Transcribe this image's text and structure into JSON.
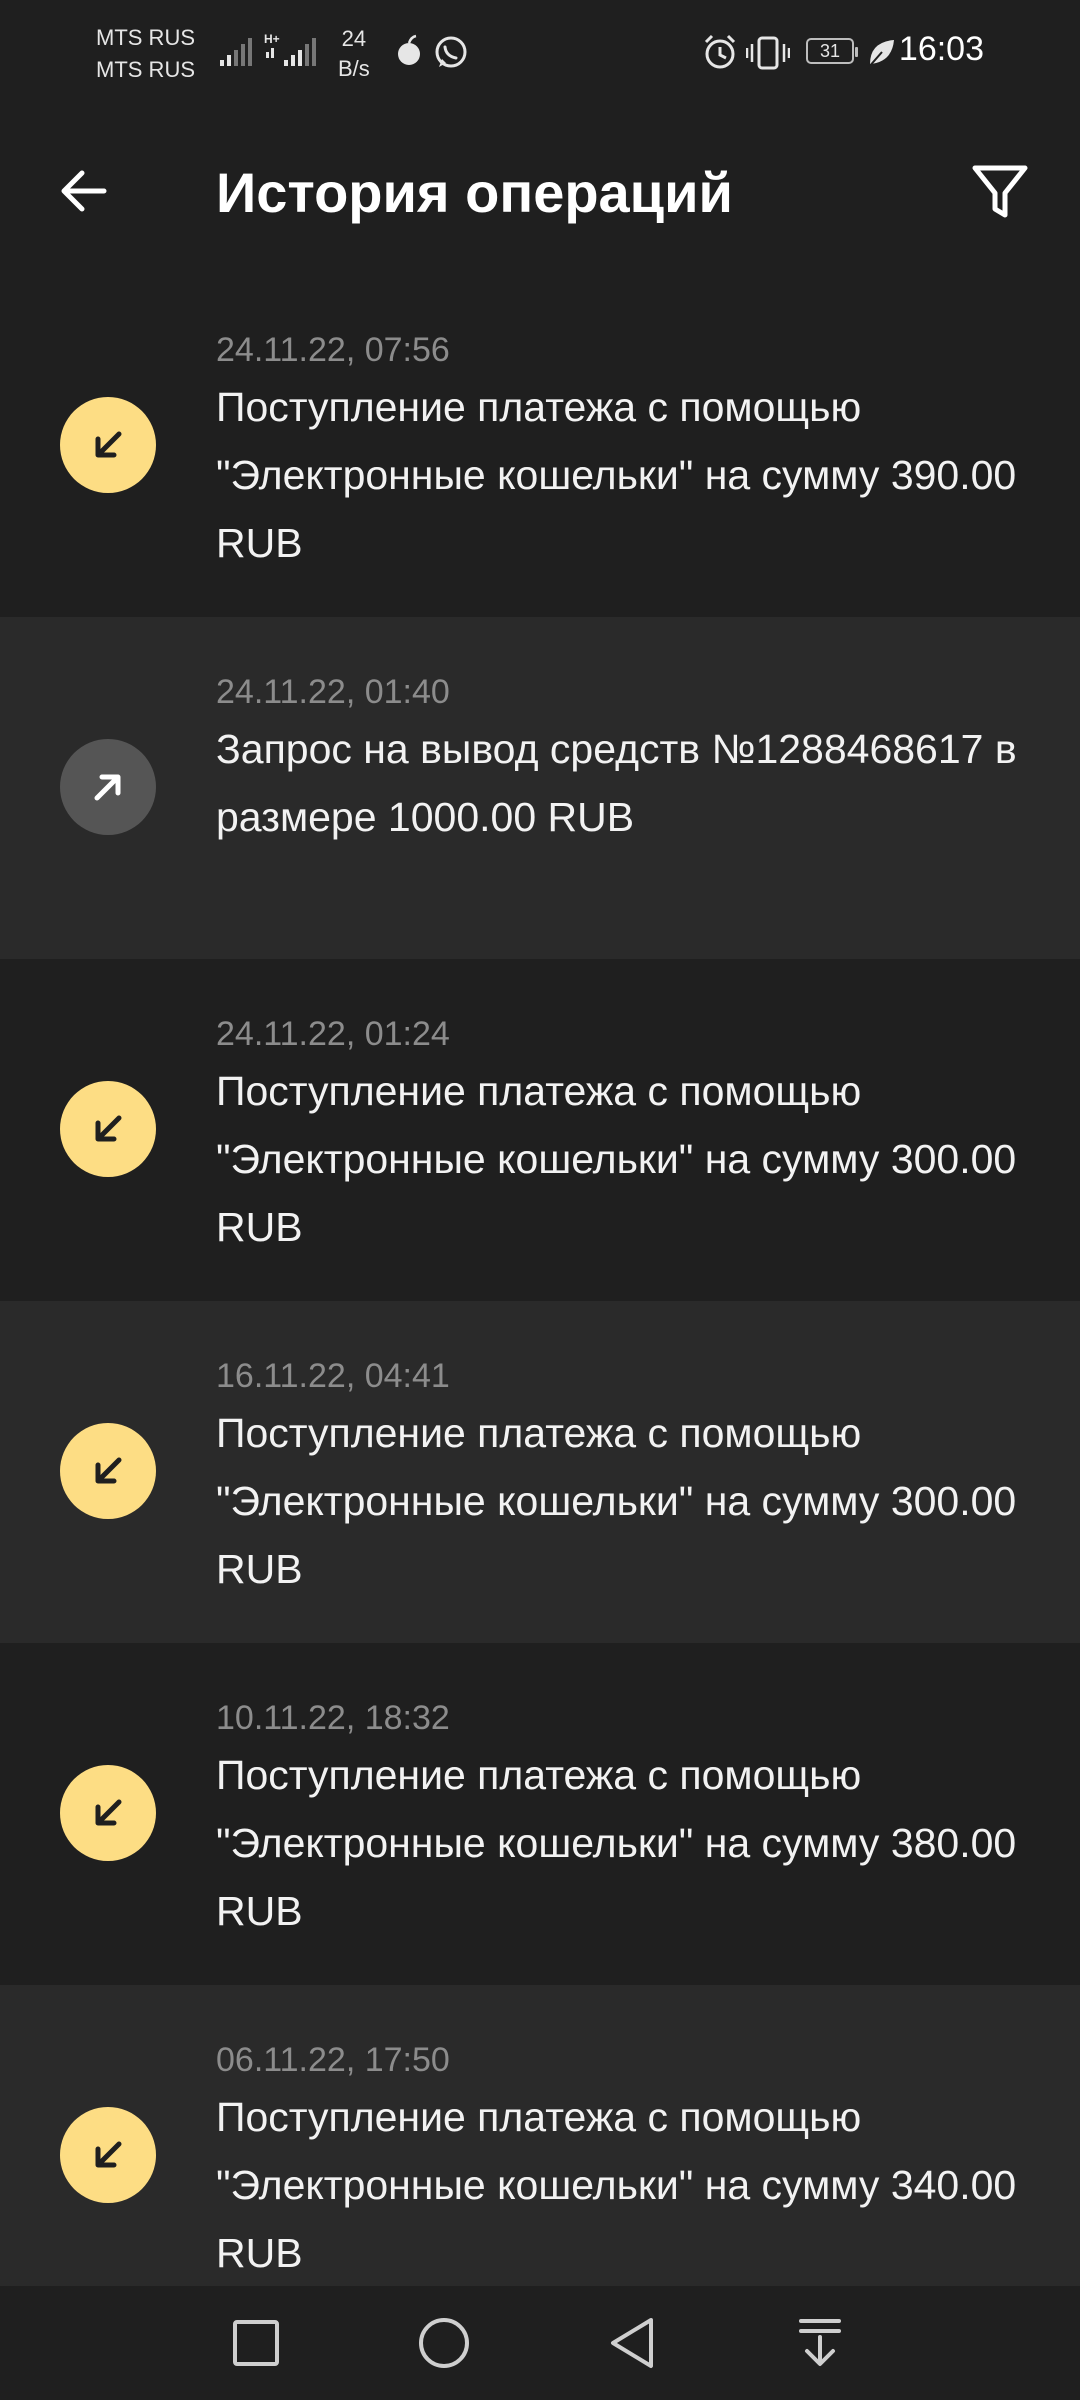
{
  "status_bar": {
    "carrier_1": "MTS RUS",
    "carrier_2": "MTS RUS",
    "network_speed_value": "24",
    "network_speed_unit": "B/s",
    "battery_level": "31",
    "time": "16:03"
  },
  "header": {
    "title": "История операций",
    "back_icon": "arrow-left-icon",
    "filter_icon": "filter-icon"
  },
  "transactions": [
    {
      "datetime": "24.11.22, 07:56",
      "description": "Поступление платежа с помощью \"Электронные кошельки\" на сумму 390.00 RUB",
      "direction": "incoming"
    },
    {
      "datetime": "24.11.22, 01:40",
      "description": "Запрос на вывод средств №1288468617 в размере 1000.00 RUB",
      "direction": "outgoing"
    },
    {
      "datetime": "24.11.22, 01:24",
      "description": "Поступление платежа с помощью \"Электронные кошельки\" на сумму 300.00 RUB",
      "direction": "incoming"
    },
    {
      "datetime": "16.11.22, 04:41",
      "description": "Поступление платежа с помощью \"Электронные кошельки\" на сумму 300.00 RUB",
      "direction": "incoming"
    },
    {
      "datetime": "10.11.22, 18:32",
      "description": "Поступление платежа с помощью \"Электронные кошельки\" на сумму 380.00 RUB",
      "direction": "incoming"
    },
    {
      "datetime": "06.11.22, 17:50",
      "description": "Поступление платежа с помощью \"Электронные кошельки\" на сумму 340.00 RUB",
      "direction": "incoming"
    }
  ],
  "colors": {
    "background": "#1f1f1f",
    "row_alt_background": "#2a2a2a",
    "incoming_accent": "#fddd84",
    "outgoing_accent": "#555555",
    "date_text": "#8c8c8c"
  },
  "nav_bar": {
    "icons": [
      "recent-apps-icon",
      "home-icon",
      "back-icon",
      "notification-pull-icon"
    ]
  }
}
